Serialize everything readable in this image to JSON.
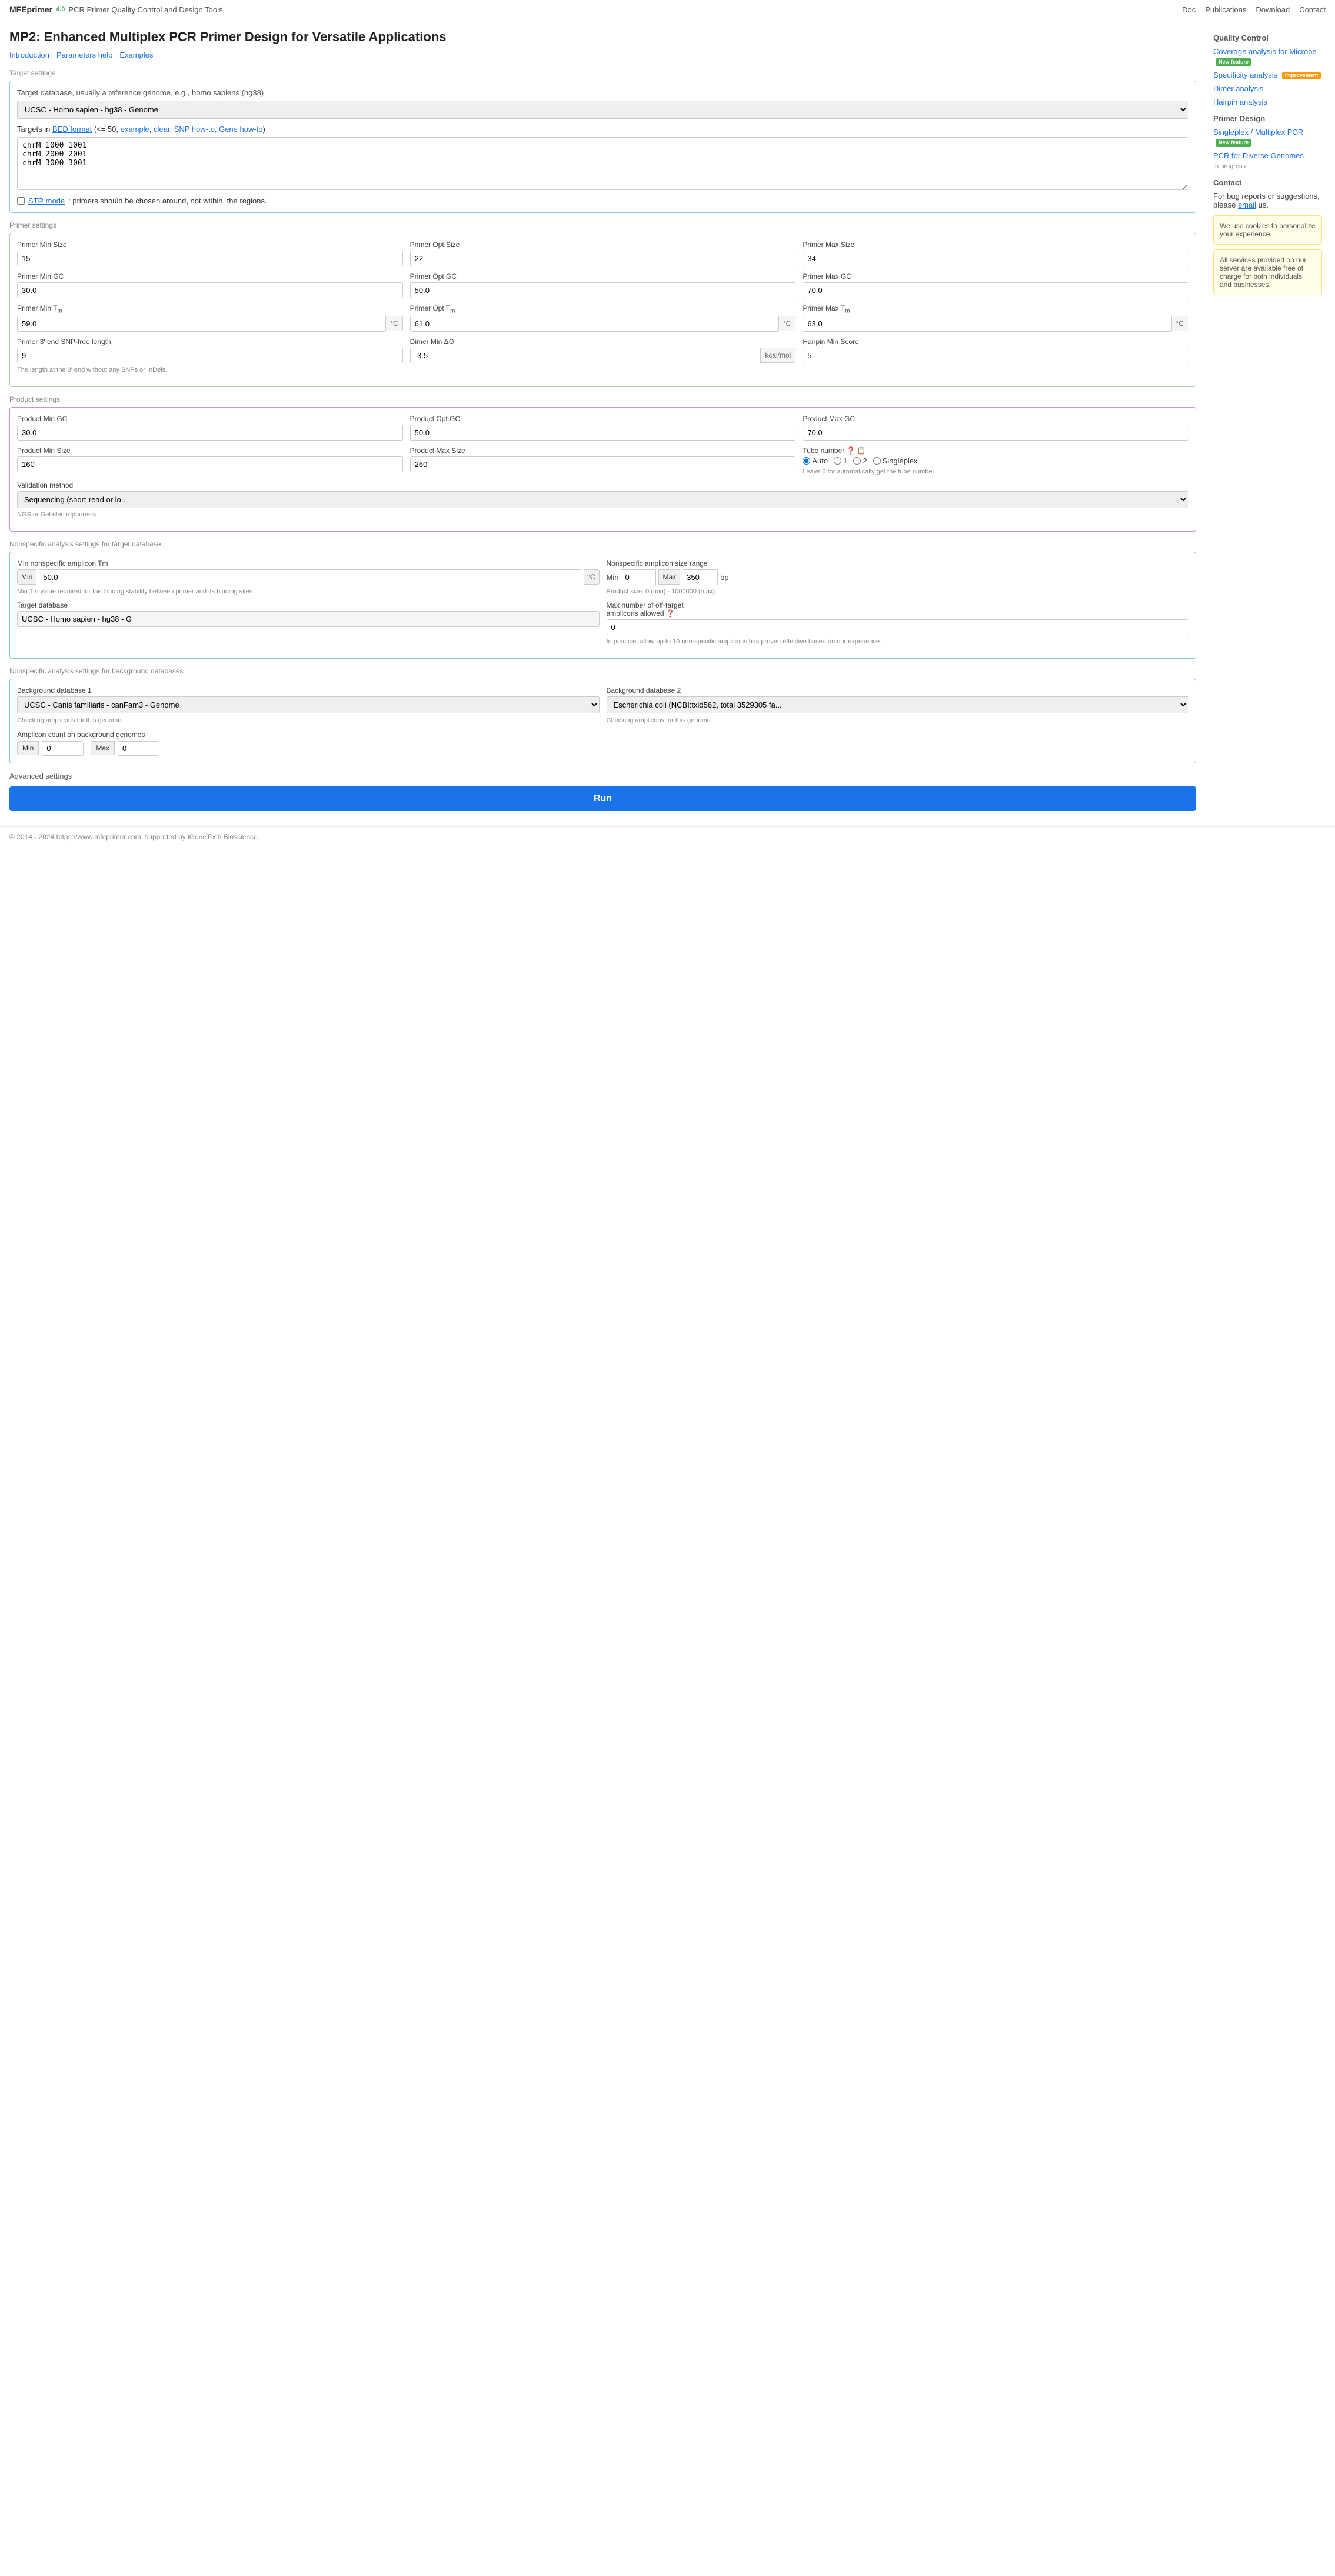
{
  "app": {
    "name": "MFEprimer",
    "version": "4.0",
    "subtitle": "PCR Primer Quality Control and Design Tools"
  },
  "nav": {
    "links": [
      "Doc",
      "Publications",
      "Download",
      "Contact"
    ]
  },
  "page": {
    "title": "MP2: Enhanced Multiplex PCR Primer Design for Versatile Applications",
    "links": [
      "Introduction",
      "Parameters help",
      "Examples"
    ]
  },
  "target_settings": {
    "section_label": "Target settings",
    "db_description": "Target database, usually a reference genome, e.g., homo sapiens (hg38)",
    "db_selected": "UCSC - Homo sapien - hg38 - Genome",
    "bed_format_label": "Targets in",
    "bed_format_link": "BED format",
    "bed_constraints": "(<= 50,",
    "bed_example": "example",
    "bed_clear": "clear",
    "bed_snp": "SNP how-to,",
    "bed_gene": "Gene how-to)",
    "targets_value": "chrM 1000 1001\nchrM 2000 2001\nchrM 3000 3001",
    "str_mode_label": "STR mode",
    "str_mode_desc": ": primers should be chosen around, not within, the regions."
  },
  "primer_settings": {
    "section_label": "Primer settings",
    "fields": [
      {
        "label": "Primer Min Size",
        "value": "15"
      },
      {
        "label": "Primer Opt Size",
        "value": "22"
      },
      {
        "label": "Primer Max Size",
        "value": "34"
      },
      {
        "label": "Primer Min GC",
        "value": "30.0"
      },
      {
        "label": "Primer Opt GC",
        "value": "50.0"
      },
      {
        "label": "Primer Max GC",
        "value": "70.0"
      },
      {
        "label": "Primer Min Tm",
        "value": "59.0",
        "unit": "°C"
      },
      {
        "label": "Primer Opt Tm",
        "value": "61.0",
        "unit": "°C"
      },
      {
        "label": "Primer Max Tm",
        "value": "63.0",
        "unit": "°C"
      },
      {
        "label": "Primer 3' end SNP-free length",
        "value": "9"
      },
      {
        "label": "Dimer Min ΔG",
        "value": "-3.5",
        "unit": "kcal/mol"
      },
      {
        "label": "Hairpin Min Score",
        "value": "5"
      }
    ],
    "snp_note": "The length at the 3' end without any SNPs or InDels."
  },
  "product_settings": {
    "section_label": "Product settings",
    "fields": [
      {
        "label": "Product Min GC",
        "value": "30.0"
      },
      {
        "label": "Product Opt GC",
        "value": "50.0"
      },
      {
        "label": "Product Max GC",
        "value": "70.0"
      },
      {
        "label": "Product Min Size",
        "value": "160"
      },
      {
        "label": "Product Max Size",
        "value": "260"
      }
    ],
    "tube_number_label": "Tube number",
    "tube_options": [
      "Auto",
      "1",
      "2",
      "Singleplex"
    ],
    "tube_selected": "Auto",
    "tube_note": "Leave 0 for automatically get the tube number.",
    "validation_label": "Validation method",
    "validation_selected": "Sequencing (short-read or lo...",
    "validation_note": "NGS or Gel electrophoresis"
  },
  "nonspecific_target": {
    "section_label": "Nonspecific analysis settings for target database",
    "min_tm_label": "Min nonspecific amplicon Tm",
    "min_tm_value": "50.0",
    "min_tm_unit": "°C",
    "min_tm_note": "Min Tm value required for the binding stability between primer and its binding sites.",
    "amplicon_range_label": "Nonspecific amplicon size range",
    "amplicon_min": "0",
    "amplicon_max": "350",
    "amplicon_unit": "bp",
    "amplicon_note": "Product size: 0 (min) - 1000000 (max).",
    "target_db_label": "Target database",
    "target_db_value": "UCSC - Homo sapien - hg38 - G",
    "max_offtarget_label": "Max number of off-target amplicons allowed",
    "max_offtarget_value": "0",
    "offtarget_note": "In practice, allow up to 10 non-specific amplicons has proven effective based on our experience."
  },
  "nonspecific_bg": {
    "section_label": "Nonspecific analysis settings for background databases",
    "bg1_label": "Background database 1",
    "bg1_value": "UCSC - Canis familiaris - canFam3 - Genome",
    "bg1_note": "Checking amplicons for this genome.",
    "bg2_label": "Background database 2",
    "bg2_value": "Escherichia coli (NCBI:txid562, total 3529305 fa...",
    "bg2_note": "Checking amplicons for this genome.",
    "amplicon_count_label": "Amplicon count on background genomes",
    "amplicon_count_min": "0",
    "amplicon_count_max": "0"
  },
  "advanced_settings": {
    "label": "Advanced settings"
  },
  "run_button": {
    "label": "Run"
  },
  "sidebar": {
    "qc_title": "Quality Control",
    "qc_items": [
      {
        "label": "Coverage analysis for Microbe",
        "badge": "New feature",
        "badge_type": "green"
      },
      {
        "label": "Specificity analysis",
        "badge": "Improvement",
        "badge_type": "orange"
      },
      {
        "label": "Dimer analysis",
        "badge": "",
        "badge_type": ""
      },
      {
        "label": "Hairpin analysis",
        "badge": "",
        "badge_type": ""
      }
    ],
    "design_title": "Primer Design",
    "design_items": [
      {
        "label": "Singleplex / Multiplex PCR",
        "badge": "New feature",
        "badge_type": "green"
      },
      {
        "label": "PCR for Diverse Genomes",
        "sub": "In progress",
        "badge": "",
        "badge_type": ""
      }
    ],
    "contact_title": "Contact",
    "contact_text": "For bug reports or suggestions, please",
    "contact_link_text": "email",
    "contact_suffix": "us.",
    "cookie_text": "We use cookies to personalize your experience.",
    "free_text": "All services provided on our server are available free of charge for both individuals and businesses."
  },
  "footer": {
    "text": "© 2014 - 2024 https://www.mfeprimer.com, supported by iGeneTech Bioscience."
  }
}
